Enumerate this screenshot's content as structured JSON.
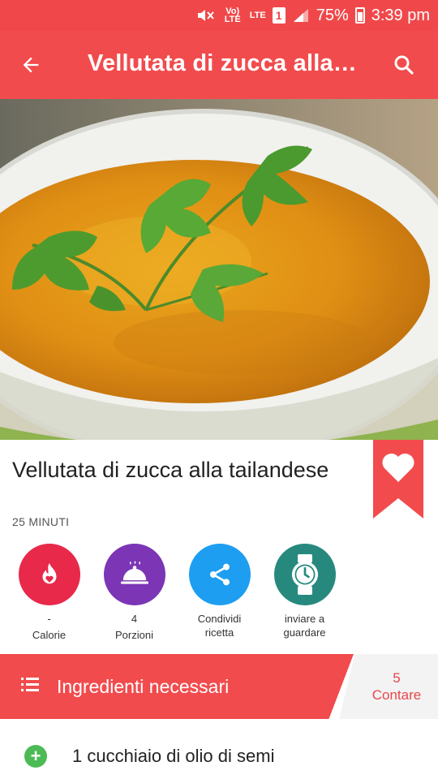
{
  "status_bar": {
    "volte": "Vo) LTE",
    "lte": "LTE",
    "sim": "1",
    "battery": "75%",
    "time": "3:39 pm"
  },
  "app_bar": {
    "title": "Vellutata di zucca alla t…",
    "icons": [
      "arrow-back-icon",
      "search-icon"
    ]
  },
  "recipe": {
    "title": "Vellutata di zucca alla tailandese",
    "time": "25 MINUTI"
  },
  "actions": [
    {
      "value": "-",
      "label": "Calorie",
      "icon": "flame-heart-icon",
      "color": "#e8294a"
    },
    {
      "value": "4",
      "label": "Porzioni",
      "icon": "serving-dish-icon",
      "color": "#7b35b5"
    },
    {
      "value": "Condividi",
      "label": "ricetta",
      "icon": "share-icon",
      "color": "#1e9ef0"
    },
    {
      "value": "inviare a",
      "label": "guardare",
      "icon": "watch-icon",
      "color": "#27897e"
    }
  ],
  "ingredients": {
    "header": "Ingredienti necessari",
    "count": "5",
    "count_label": "Contare",
    "items": [
      "1 cucchiaio di olio di semi"
    ]
  },
  "colors": {
    "primary": "#f24b4d",
    "status_bar": "#f0484a",
    "add_green": "#4cbb55"
  }
}
